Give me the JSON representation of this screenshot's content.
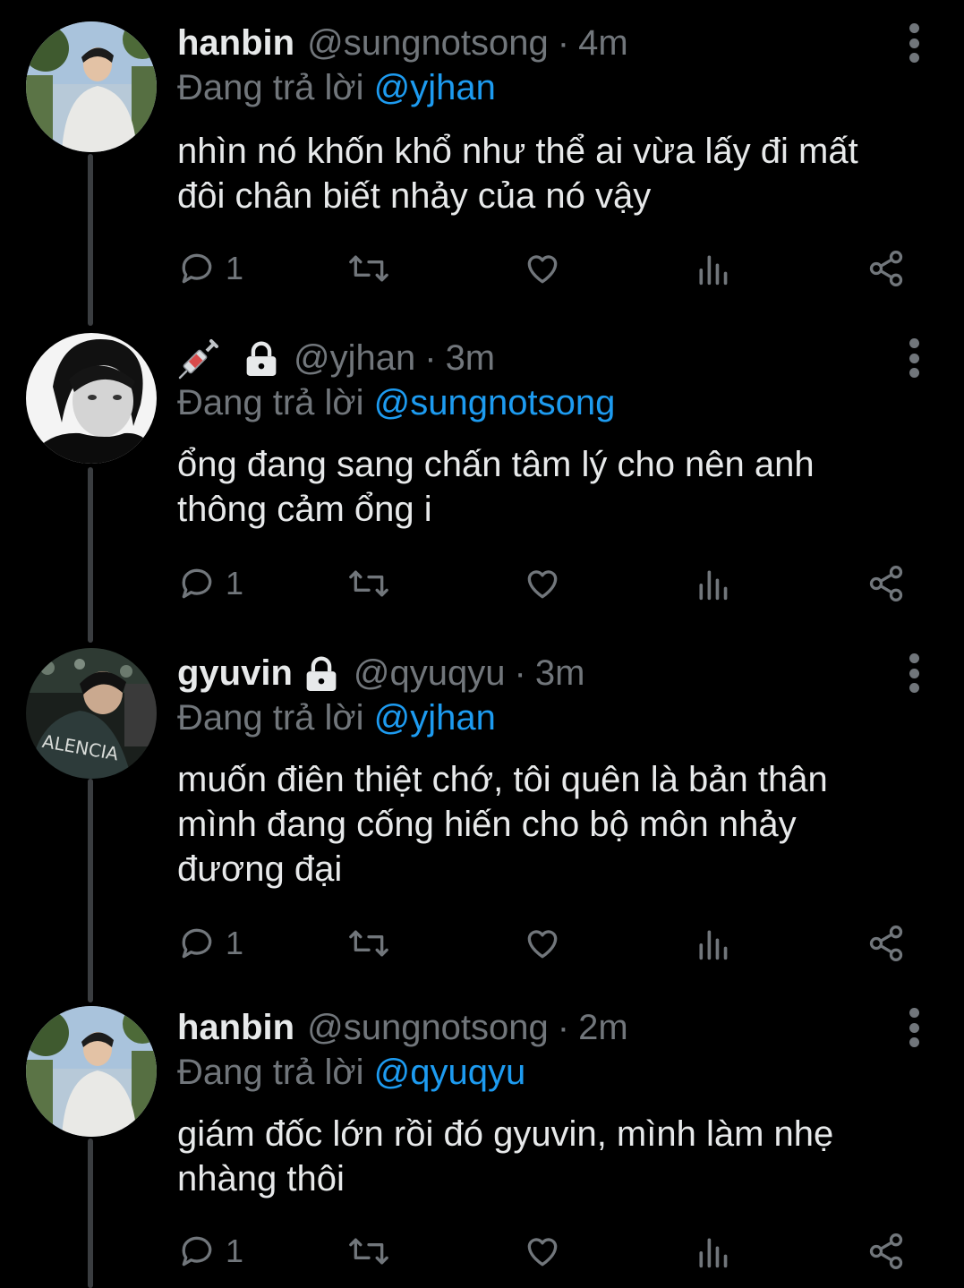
{
  "colors": {
    "background": "#000000",
    "text": "#e7e9ea",
    "muted": "#71767b",
    "link": "#1d9bf0"
  },
  "tweets": [
    {
      "name": "hanbin",
      "handle": "@sungnotsong",
      "time": "4m",
      "reply_prefix": "Đang trả lời",
      "reply_to": "@yjhan",
      "text_lines": [
        "nhìn nó khốn khổ như thể ai vừa lấy đi mất",
        "đôi chân biết nhảy của nó vậy"
      ],
      "reply_count": "1"
    },
    {
      "name": "",
      "name_emoji": "syringe-icon",
      "locked": true,
      "handle": "@yjhan",
      "time": "3m",
      "reply_prefix": "Đang trả lời",
      "reply_to": "@sungnotsong",
      "text_lines": [
        "ổng đang sang chấn tâm lý cho nên anh",
        "thông cảm ổng i"
      ],
      "reply_count": "1"
    },
    {
      "name": "gyuvin",
      "locked": true,
      "handle": "@qyuqyu",
      "time": "3m",
      "reply_prefix": "Đang trả lời",
      "reply_to": "@yjhan",
      "text_lines": [
        "muốn điên thiệt chớ, tôi quên là bản thân",
        "mình đang cống hiến cho bộ môn nhảy",
        "đương đại"
      ],
      "reply_count": "1"
    },
    {
      "name": "hanbin",
      "handle": "@sungnotsong",
      "time": "2m",
      "reply_prefix": "Đang trả lời",
      "reply_to": "@qyuqyu",
      "text_lines": [
        "giám đốc lớn rồi đó gyuvin, mình làm nhẹ",
        "nhàng thôi"
      ],
      "reply_count": "1"
    }
  ],
  "separator": "·"
}
